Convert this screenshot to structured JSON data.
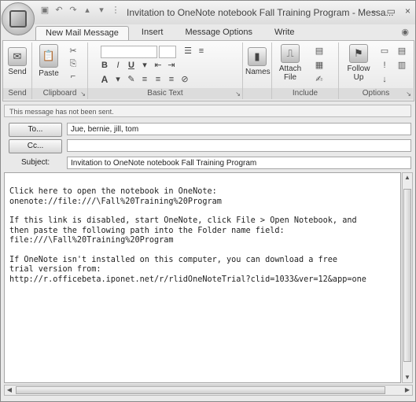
{
  "window": {
    "title": "Invitation to OneNote notebook Fall Training Program - Messa...",
    "controls": [
      "–",
      "▭",
      "×"
    ]
  },
  "qat_icons": [
    "save-icon",
    "undo-icon",
    "redo-icon",
    "up-arrow-icon",
    "down-arrow-icon",
    "customize-icon"
  ],
  "tabs": [
    {
      "label": "New Mail Message",
      "active": true
    },
    {
      "label": "Insert",
      "active": false
    },
    {
      "label": "Message Options",
      "active": false
    },
    {
      "label": "Write",
      "active": false
    }
  ],
  "ribbon": {
    "send": {
      "label": "Send",
      "group": "Send"
    },
    "clipboard": {
      "paste_label": "Paste",
      "group": "Clipboard"
    },
    "basic_text": {
      "group": "Basic Text"
    },
    "names": {
      "label": "Names"
    },
    "include": {
      "attach_label": "Attach File",
      "group": "Include"
    },
    "options": {
      "follow_up_label": "Follow Up",
      "group": "Options"
    }
  },
  "info_bar": "This message has not been sent.",
  "to": {
    "button": "To...",
    "value": "Jue, bernie, jill, tom"
  },
  "cc": {
    "button": "Cc...",
    "value": ""
  },
  "subject": {
    "label": "Subject:",
    "value": "Invitation to OneNote notebook Fall Training Program"
  },
  "body": {
    "line1": "Click here to open the notebook in OneNote:",
    "line2": "onenote://file:///\\Fall%20Training%20Program",
    "line3": "If this link is disabled, start OneNote, click File > Open Notebook, and",
    "line4": "then paste the following path into the Folder name field:",
    "line5": "file:///\\Fall%20Training%20Program",
    "line6": "If OneNote isn't installed on this computer, you can download a free",
    "line7": "trial version from:",
    "line8": "http://r.officebeta.iponet.net/r/rlidOneNoteTrial?clid=1033&ver=12&app=one"
  }
}
